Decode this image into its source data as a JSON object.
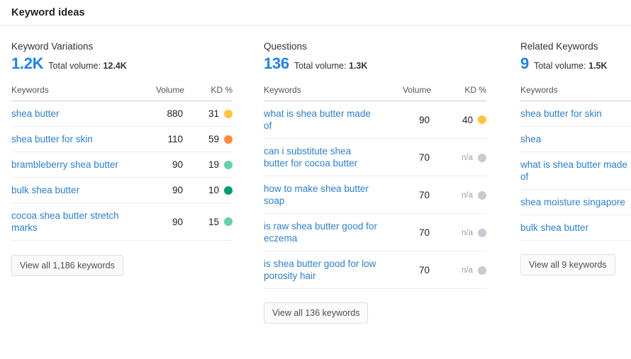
{
  "header": {
    "title": "Keyword ideas"
  },
  "colors": {
    "accent_blue": "#1a84ef",
    "link_blue": "#2a7fd4",
    "kd_yellow": "#ffc43d",
    "kd_orange": "#fd8c3c",
    "kd_light_green": "#5fd3a6",
    "kd_dark_green": "#009c76",
    "kd_na_gray": "#c8cbd2"
  },
  "columns": [
    {
      "name": "Keyword Variations",
      "count": "1.2K",
      "total_label": "Total volume:",
      "total_value": "12.4K",
      "headers": {
        "keyword": "Keywords",
        "volume": "Volume",
        "kd": "KD %"
      },
      "rows": [
        {
          "keyword": "shea butter",
          "volume": "880",
          "kd": "31",
          "dot": "#ffc43d"
        },
        {
          "keyword": "shea butter for skin",
          "volume": "110",
          "kd": "59",
          "dot": "#fd8c3c"
        },
        {
          "keyword": "brambleberry shea butter",
          "volume": "90",
          "kd": "19",
          "dot": "#5fd3a6"
        },
        {
          "keyword": "bulk shea butter",
          "volume": "90",
          "kd": "10",
          "dot": "#009c76"
        },
        {
          "keyword": "cocoa shea butter stretch marks",
          "volume": "90",
          "kd": "15",
          "dot": "#5fd3a6"
        }
      ],
      "view_all": "View all 1,186 keywords"
    },
    {
      "name": "Questions",
      "count": "136",
      "total_label": "Total volume:",
      "total_value": "1.3K",
      "headers": {
        "keyword": "Keywords",
        "volume": "Volume",
        "kd": "KD %"
      },
      "rows": [
        {
          "keyword": "what is shea butter made of",
          "volume": "90",
          "kd": "40",
          "dot": "#ffc43d"
        },
        {
          "keyword": "can i substitute shea butter for cocoa butter",
          "volume": "70",
          "kd": "n/a",
          "dot": "#c8cbd2"
        },
        {
          "keyword": "how to make shea butter soap",
          "volume": "70",
          "kd": "n/a",
          "dot": "#c8cbd2"
        },
        {
          "keyword": "is raw shea butter good for eczema",
          "volume": "70",
          "kd": "n/a",
          "dot": "#c8cbd2"
        },
        {
          "keyword": "is shea butter good for low porosity hair",
          "volume": "70",
          "kd": "n/a",
          "dot": "#c8cbd2"
        }
      ],
      "view_all": "View all 136 keywords"
    },
    {
      "name": "Related Keywords",
      "count": "9",
      "total_label": "Total volume:",
      "total_value": "1.5K",
      "headers": {
        "keyword": "Keywords"
      },
      "rows": [
        {
          "keyword": "shea butter for skin"
        },
        {
          "keyword": "shea"
        },
        {
          "keyword": "what is shea butter made of"
        },
        {
          "keyword": "shea moisture singapore"
        },
        {
          "keyword": "bulk shea butter"
        }
      ],
      "view_all": "View all 9 keywords"
    }
  ]
}
